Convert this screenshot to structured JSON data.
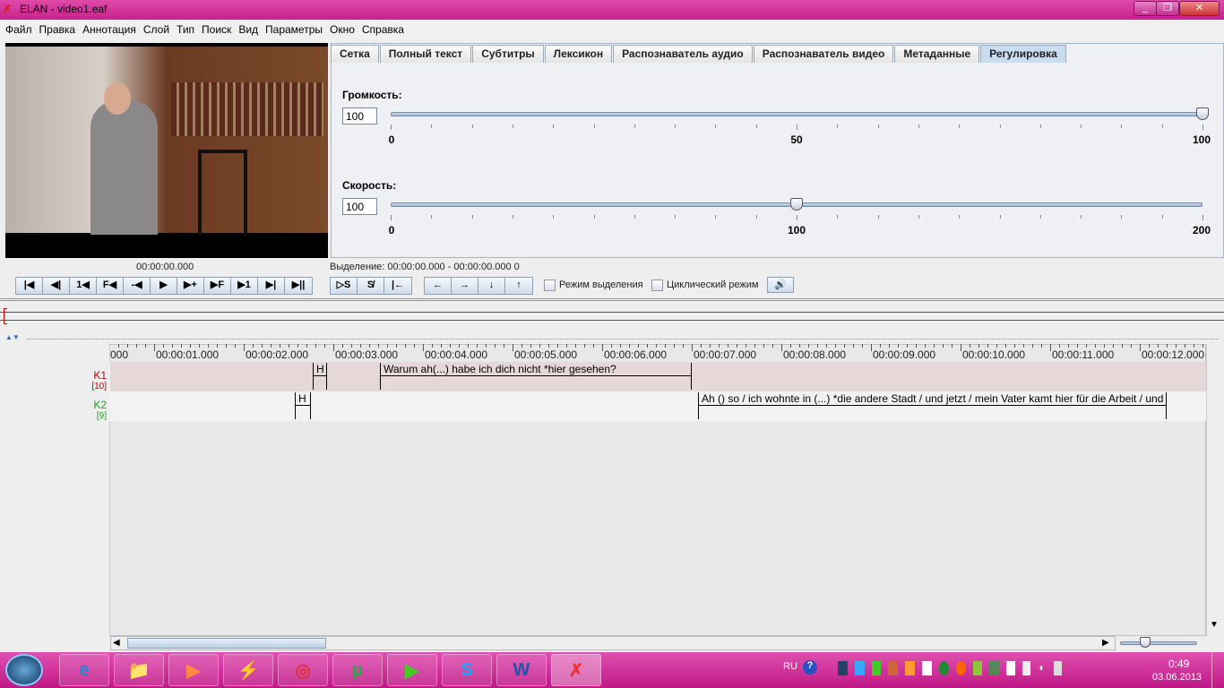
{
  "window": {
    "title": "ELAN - video1.eaf",
    "controls": [
      "_",
      "❐",
      "✕"
    ]
  },
  "menu": [
    "Файл",
    "Правка",
    "Аннотация",
    "Слой",
    "Тип",
    "Поиск",
    "Вид",
    "Параметры",
    "Окно",
    "Справка"
  ],
  "tabs": [
    "Сетка",
    "Полный текст",
    "Субтитры",
    "Лексикон",
    "Распознаватель аудио",
    "Распознаватель видео",
    "Метаданные",
    "Регулировка"
  ],
  "active_tab": "Регулировка",
  "volume": {
    "label": "Громкость:",
    "value": "100",
    "min": "0",
    "mid": "50",
    "max": "100",
    "fraction": 1.0
  },
  "speed": {
    "label": "Скорость:",
    "value": "100",
    "min": "0",
    "mid": "100",
    "max": "200",
    "fraction": 0.5
  },
  "media_time": "00:00:00.000",
  "selection": "Выделение: 00:00:00.000 - 00:00:00.000  0",
  "player_buttons": [
    "|◀",
    "◀|",
    "1◀",
    "F◀",
    "-◀",
    "▶",
    "▶+",
    "▶F",
    "▶1",
    "▶|",
    "▶||"
  ],
  "selection_buttons": [
    "▷S",
    "S̸",
    "|←"
  ],
  "nav_buttons": [
    "←",
    "→",
    "↓",
    "↑"
  ],
  "selection_mode": "Режим выделения",
  "loop_mode": "Циклический режим",
  "ruler_labels": [
    "000",
    "00:00:01.000",
    "00:00:02.000",
    "00:00:03.000",
    "00:00:04.000",
    "00:00:05.000",
    "00:00:06.000",
    "00:00:07.000",
    "00:00:08.000",
    "00:00:09.000",
    "00:00:10.000",
    "00:00:11.000",
    "00:00:12.000"
  ],
  "tiers": [
    {
      "name": "K1",
      "count": "[10]",
      "color": "#d00000",
      "annotations": [
        {
          "text": "H",
          "start": 2.77,
          "end": 2.93
        },
        {
          "text": "Warum ah(...)  habe ich dich nicht *hier gesehen?",
          "start": 3.52,
          "end": 7.0
        }
      ]
    },
    {
      "name": "K2",
      "count": "[9]",
      "color": "#20a020",
      "annotations": [
        {
          "text": "H",
          "start": 2.57,
          "end": 2.75
        },
        {
          "text": "Ah () so / ich wohnte  in (...) *die andere Stadt / und jetzt / mein Vater kamt hier für die Arbeit / und",
          "start": 7.07,
          "end": 12.3
        }
      ]
    }
  ],
  "taskbar": {
    "lang": "RU",
    "time": "0:49",
    "date": "03.06.2013",
    "apps": [
      "e",
      "📁",
      "▶",
      "⚡",
      "◎",
      "µ",
      "▶",
      "S",
      "W",
      "✗"
    ]
  }
}
